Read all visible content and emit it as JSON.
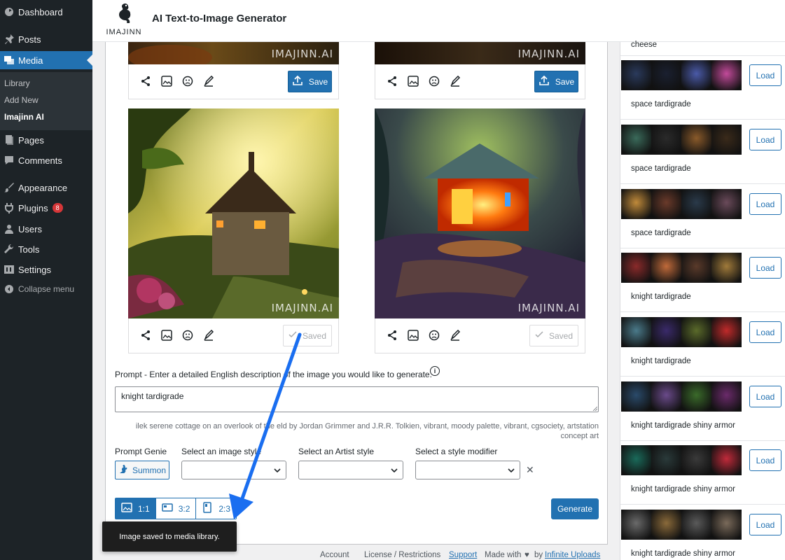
{
  "app": {
    "title": "AI Text-to-Image Generator",
    "logo_text": "IMAJINN",
    "watermark": "IMAJINN.AI"
  },
  "sidebar": {
    "dashboard": "Dashboard",
    "posts": "Posts",
    "media": "Media",
    "media_sub": [
      "Library",
      "Add New",
      "Imajinn AI"
    ],
    "pages": "Pages",
    "comments": "Comments",
    "appearance": "Appearance",
    "plugins": "Plugins",
    "plugins_badge": "8",
    "users": "Users",
    "tools": "Tools",
    "settings": "Settings",
    "collapse": "Collapse menu"
  },
  "images": {
    "save_label": "Save",
    "saved_label": "Saved"
  },
  "form": {
    "prompt_label": "Prompt - Enter a detailed English description of the image you would like to generate.",
    "prompt_value": "knight tardigrade",
    "suggestion": "ilek serene cottage on an overlook of the eld by Jordan Grimmer and J.R.R. Tolkien, vibrant, moody palette, vibrant, cgsociety, artstation concept art",
    "genie_label": "Prompt Genie",
    "summon_label": "Summon",
    "image_style_label": "Select an image style",
    "artist_style_label": "Select an Artist style",
    "modifier_label": "Select a style modifier",
    "ratios": [
      "1:1",
      "3:2",
      "2:3"
    ],
    "generate_label": "Generate"
  },
  "toast": "Image saved to media library.",
  "footer": {
    "account": "Account",
    "license": "License / Restrictions",
    "support": "Support",
    "made_with": "Made with",
    "by": "by",
    "infinite_uploads": "Infinite Uploads"
  },
  "history": [
    {
      "caption": "cheese",
      "load": ""
    },
    {
      "caption": "space tardigrade",
      "load": "Load",
      "colors": [
        "#2a3a5c",
        "#1a2030",
        "#4a5aa8",
        "#c24a9a"
      ]
    },
    {
      "caption": "space tardigrade",
      "load": "Load",
      "colors": [
        "#3a6a5a",
        "#2a2a2a",
        "#8a5a2a",
        "#3a2a1a"
      ]
    },
    {
      "caption": "space tardigrade",
      "load": "Load",
      "colors": [
        "#c08a3a",
        "#6a3a2a",
        "#2a3a4a",
        "#6a4a5a"
      ]
    },
    {
      "caption": "knight tardigrade",
      "load": "Load",
      "colors": [
        "#8a2a2a",
        "#c06a3a",
        "#5a3a2a",
        "#a07a3a"
      ]
    },
    {
      "caption": "knight tardigrade",
      "load": "Load",
      "colors": [
        "#4a7a8a",
        "#3a2a6a",
        "#5a6a2a",
        "#c02a2a"
      ]
    },
    {
      "caption": "knight tardigrade shiny armor",
      "load": "Load",
      "colors": [
        "#2a4a6a",
        "#6a4a8a",
        "#3a6a2a",
        "#6a2a6a"
      ]
    },
    {
      "caption": "knight tardigrade shiny armor",
      "load": "Load",
      "colors": [
        "#1a6a5a",
        "#2a3a3a",
        "#3a3a3a",
        "#c02a3a"
      ]
    },
    {
      "caption": "knight tardigrade shiny armor",
      "load": "Load",
      "colors": [
        "#6a6a6a",
        "#8a6a3a",
        "#5a5a5a",
        "#7a6a5a"
      ]
    }
  ],
  "colors": {
    "accent": "#2271b1",
    "sidebar_bg": "#1d2327",
    "toast_bg": "#1e1e1e",
    "badge": "#d63638"
  }
}
